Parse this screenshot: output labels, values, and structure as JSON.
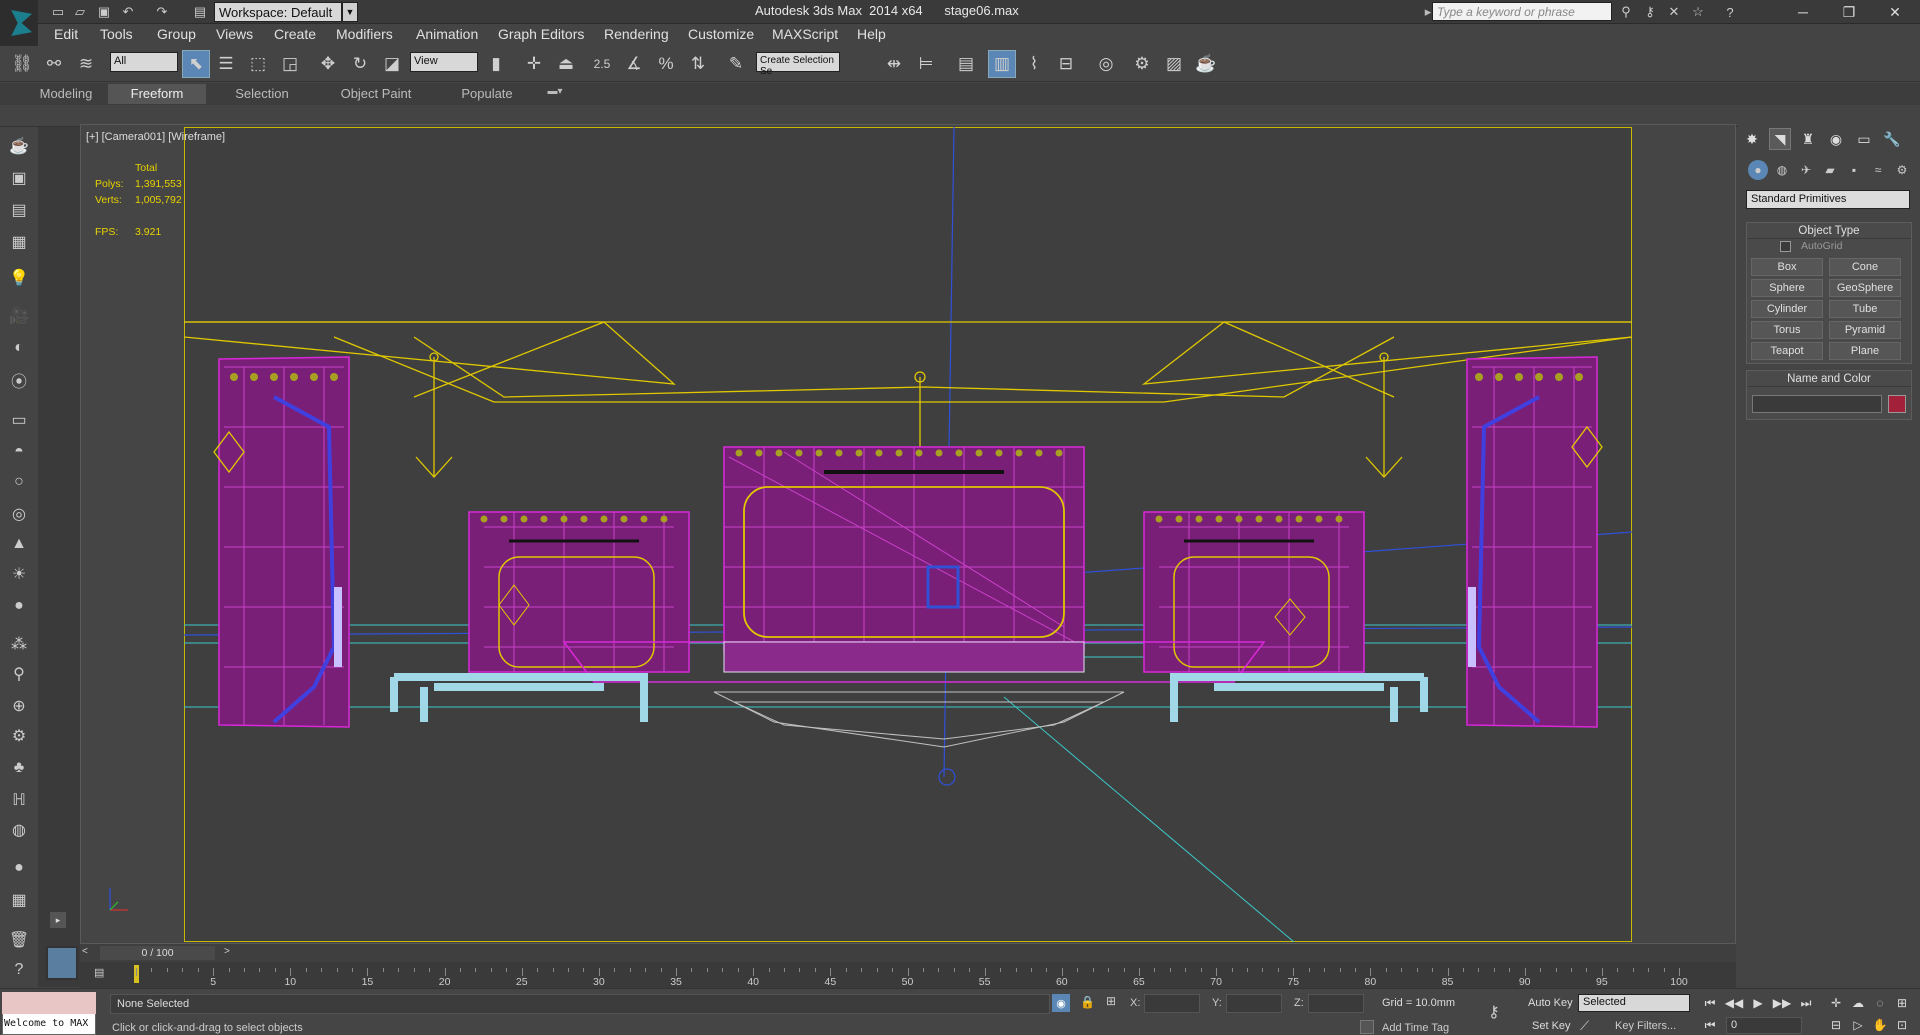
{
  "app": {
    "title": "Autodesk 3ds Max  2014 x64      stage06.max",
    "workspace": "Workspace: Default",
    "search_placeholder": "Type a keyword or phrase"
  },
  "menu": [
    "Edit",
    "Tools",
    "Group",
    "Views",
    "Create",
    "Modifiers",
    "Animation",
    "Graph Editors",
    "Rendering",
    "Customize",
    "MAXScript",
    "Help"
  ],
  "toolbar": {
    "filter": "All",
    "ref_coord": "View",
    "snap_angle": "2.5",
    "selection_set": "Create Selection Se"
  },
  "ribbon_tabs": [
    "Modeling",
    "Freeform",
    "Selection",
    "Object Paint",
    "Populate"
  ],
  "viewport": {
    "label": "[+] [Camera001] [Wireframe]",
    "stats": {
      "total_label": "Total",
      "polys_label": "Polys:",
      "polys": "1,391,553",
      "verts_label": "Verts:",
      "verts": "1,005,792",
      "fps_label": "FPS:",
      "fps": "3.921"
    }
  },
  "command_panel": {
    "dropdown": "Standard Primitives",
    "object_type_title": "Object Type",
    "autogrid": "AutoGrid",
    "primitives": [
      "Box",
      "Cone",
      "Sphere",
      "GeoSphere",
      "Cylinder",
      "Tube",
      "Torus",
      "Pyramid",
      "Teapot",
      "Plane"
    ],
    "name_color_title": "Name and Color",
    "object_color": "#a3203a"
  },
  "timeline": {
    "frame_label": "0 / 100",
    "ticks": [
      "5",
      "10",
      "15",
      "20",
      "25",
      "30",
      "35",
      "40",
      "45",
      "50",
      "55",
      "60",
      "65",
      "70",
      "75",
      "80",
      "85",
      "90",
      "95",
      "100"
    ]
  },
  "status": {
    "maxscript": "Welcome to MAX",
    "selection": "None Selected",
    "prompt": "Click or click-and-drag to select objects",
    "x_label": "X:",
    "y_label": "Y:",
    "z_label": "Z:",
    "grid": "Grid = 10.0mm",
    "add_time_tag": "Add Time Tag",
    "auto_key": "Auto Key",
    "set_key": "Set Key",
    "key_mode": "Selected",
    "key_filters": "Key Filters...",
    "current_frame": "0"
  }
}
